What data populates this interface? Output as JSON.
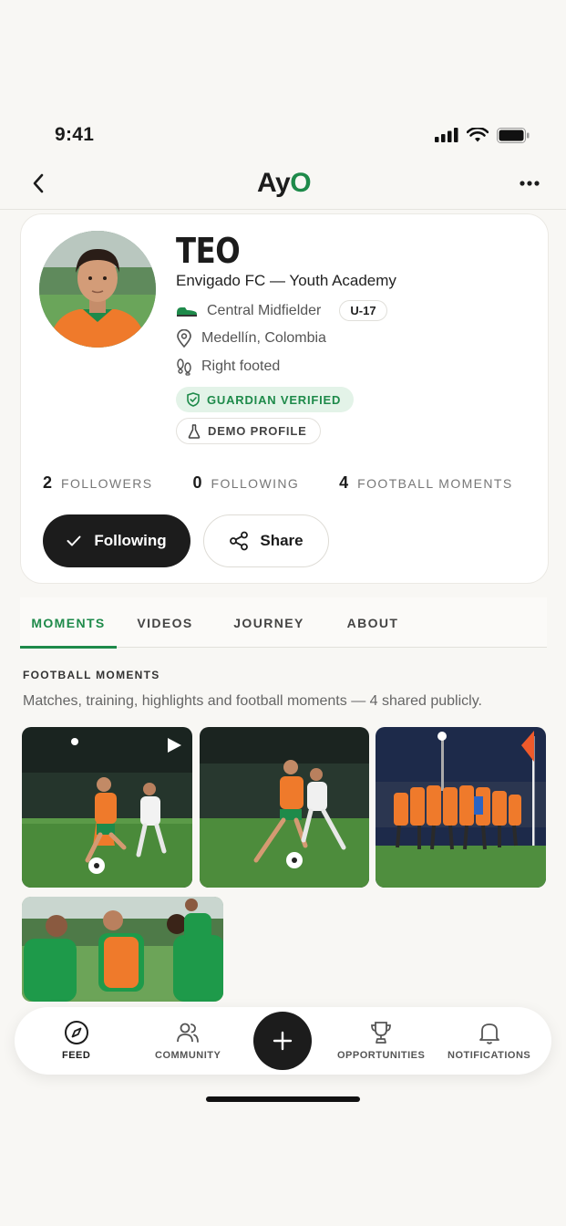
{
  "status_bar": {
    "time": "9:41"
  },
  "nav": {
    "logo_main": "Ay",
    "logo_accent": "O"
  },
  "profile": {
    "name": "TEO",
    "club": "Envigado FC — Youth Academy",
    "position": "Central Midfielder",
    "age_group": "U-17",
    "location": "Medellín, Colombia",
    "foot": "Right footed",
    "badge_verified": "GUARDIAN VERIFIED",
    "badge_demo": "DEMO PROFILE"
  },
  "stats": [
    {
      "value": "2",
      "label": "FOLLOWERS"
    },
    {
      "value": "0",
      "label": "FOLLOWING"
    },
    {
      "value": "4",
      "label": "FOOTBALL MOMENTS"
    }
  ],
  "actions": {
    "following_label": "Following",
    "share_label": "Share"
  },
  "tabs": [
    {
      "label": "MOMENTS",
      "active": true
    },
    {
      "label": "VIDEOS"
    },
    {
      "label": "JOURNEY"
    },
    {
      "label": "ABOUT"
    }
  ],
  "section": {
    "title": "FOOTBALL MOMENTS",
    "description": "Matches, training, highlights and football moments — 4 shared publicly."
  },
  "bottom_nav": {
    "feed": "FEED",
    "community": "COMMUNITY",
    "opportunities": "OPPORTUNITIES",
    "notifications": "NOTIFICATIONS"
  },
  "colors": {
    "accent": "#1e8a4a",
    "jersey_orange": "#ef7a2b",
    "dark": "#1c1c1c"
  }
}
